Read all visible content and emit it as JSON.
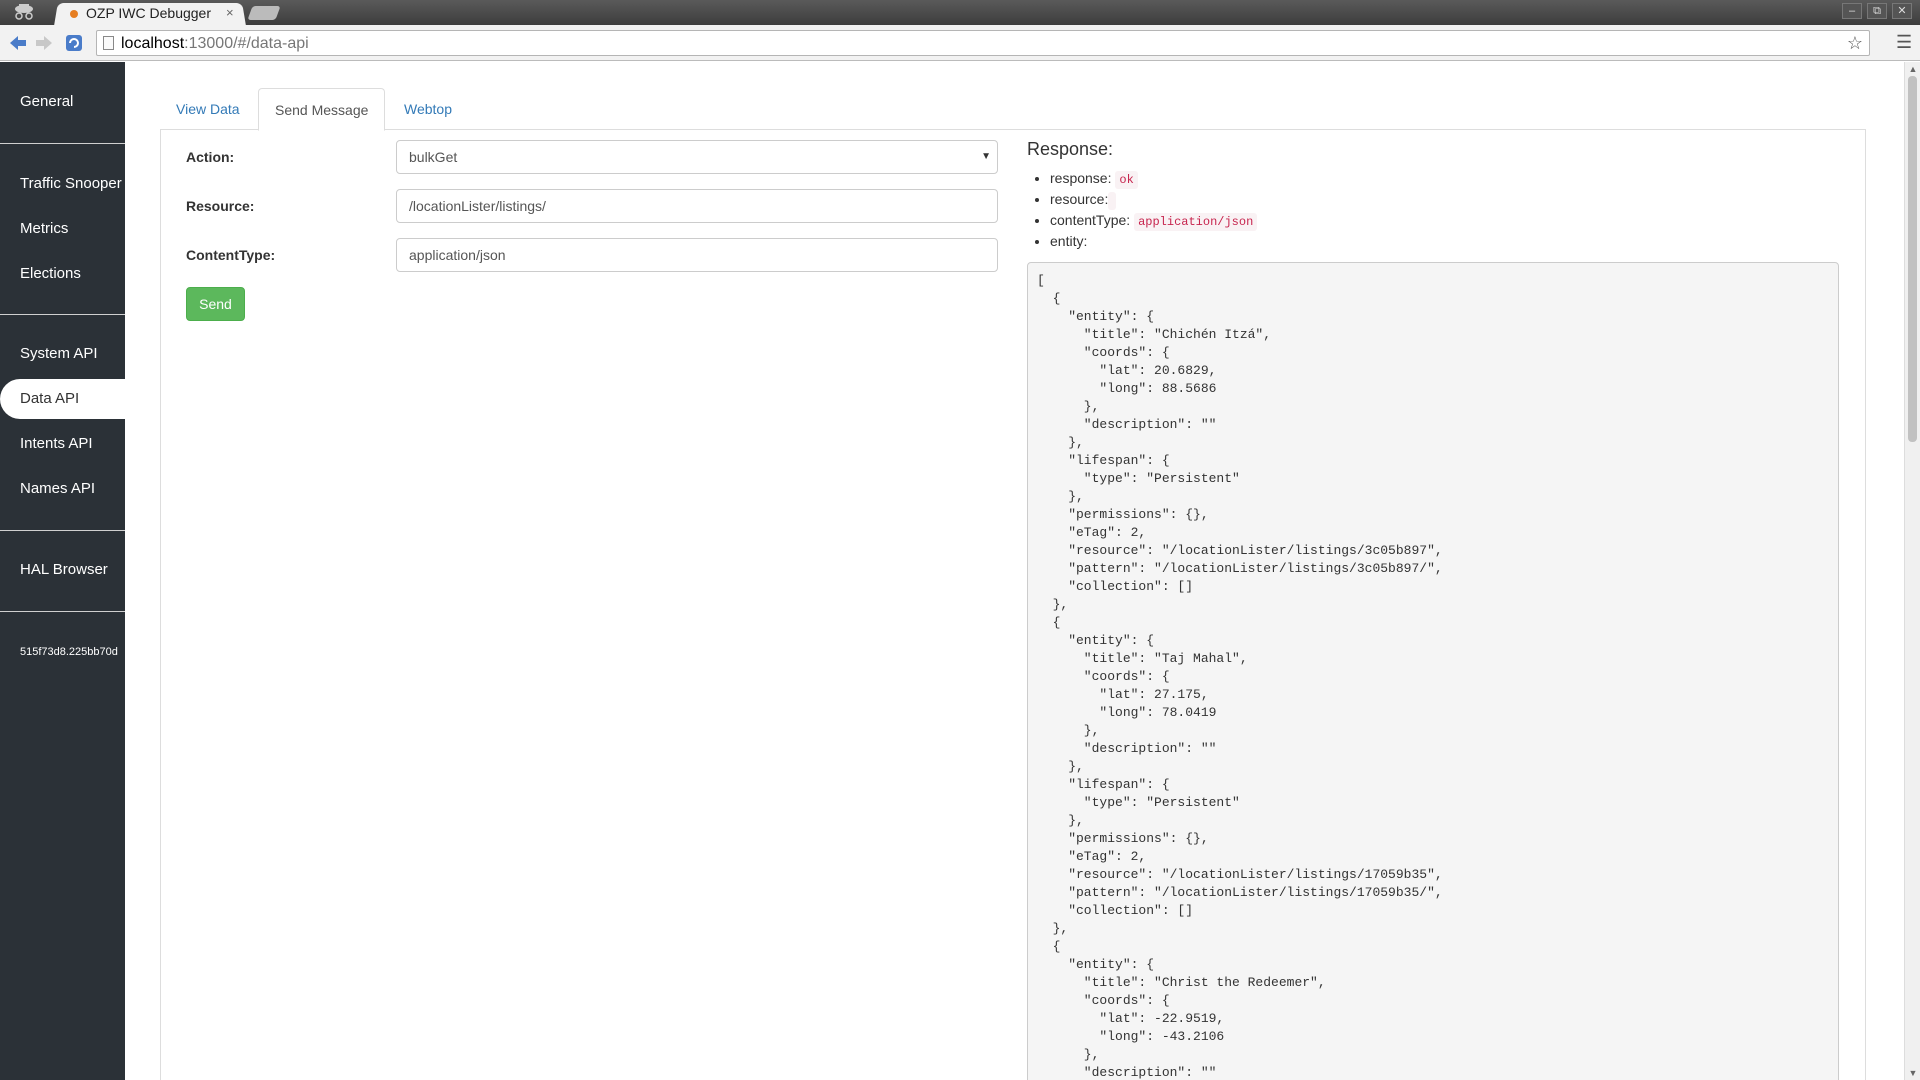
{
  "browser": {
    "tab_title": "OZP IWC Debugger",
    "tab_close": "×",
    "url_host": "localhost",
    "url_rest": ":13000/#/data-api",
    "window_controls": [
      "–",
      "⧉",
      "✕"
    ],
    "icons": {
      "back": "back-arrow-icon",
      "forward": "forward-arrow-icon",
      "reload": "reload-icon",
      "bookmark": "star-icon",
      "menu": "hamburger-menu-icon"
    }
  },
  "sidebar": {
    "items": [
      {
        "label": "General"
      },
      {
        "label": "Traffic Snooper"
      },
      {
        "label": "Metrics"
      },
      {
        "label": "Elections"
      },
      {
        "label": "System API"
      },
      {
        "label": "Data API",
        "active": true
      },
      {
        "label": "Intents API"
      },
      {
        "label": "Names API"
      },
      {
        "label": "HAL Browser"
      }
    ],
    "client_id": "515f73d8.225bb70d"
  },
  "tabs": [
    {
      "label": "View Data"
    },
    {
      "label": "Send Message",
      "active": true
    },
    {
      "label": "Webtop"
    }
  ],
  "form": {
    "action_label": "Action:",
    "action_value": "bulkGet",
    "resource_label": "Resource:",
    "resource_value": "/locationLister/listings/",
    "content_type_label": "ContentType:",
    "content_type_value": "application/json",
    "send_label": "Send"
  },
  "response": {
    "title": "Response:",
    "fields": {
      "response_label": "response:",
      "response_value": "ok",
      "resource_label": "resource:",
      "resource_value": "",
      "content_type_label": "contentType:",
      "content_type_value": "application/json",
      "entity_label": "entity:"
    },
    "body": "[\n  {\n    \"entity\": {\n      \"title\": \"Chichén Itzá\",\n      \"coords\": {\n        \"lat\": 20.6829,\n        \"long\": 88.5686\n      },\n      \"description\": \"\"\n    },\n    \"lifespan\": {\n      \"type\": \"Persistent\"\n    },\n    \"permissions\": {},\n    \"eTag\": 2,\n    \"resource\": \"/locationLister/listings/3c05b897\",\n    \"pattern\": \"/locationLister/listings/3c05b897/\",\n    \"collection\": []\n  },\n  {\n    \"entity\": {\n      \"title\": \"Taj Mahal\",\n      \"coords\": {\n        \"lat\": 27.175,\n        \"long\": 78.0419\n      },\n      \"description\": \"\"\n    },\n    \"lifespan\": {\n      \"type\": \"Persistent\"\n    },\n    \"permissions\": {},\n    \"eTag\": 2,\n    \"resource\": \"/locationLister/listings/17059b35\",\n    \"pattern\": \"/locationLister/listings/17059b35/\",\n    \"collection\": []\n  },\n  {\n    \"entity\": {\n      \"title\": \"Christ the Redeemer\",\n      \"coords\": {\n        \"lat\": -22.9519,\n        \"long\": -43.2106\n      },\n      \"description\": \"\""
  },
  "colors": {
    "sidebar_bg": "#2b3137",
    "link": "#337ab7",
    "send_button": "#5cb85c",
    "code_text": "#c7254e"
  }
}
